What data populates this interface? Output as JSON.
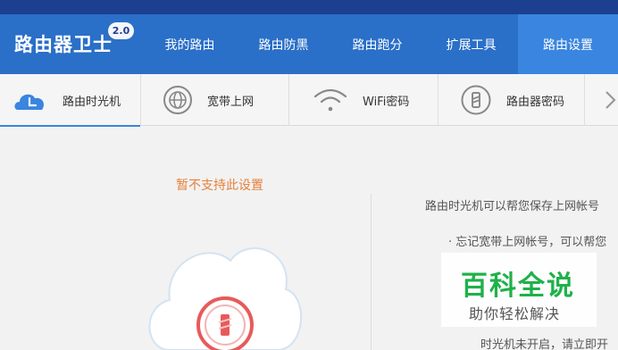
{
  "header": {
    "brand": "路由器卫士",
    "version_badge": "2.0",
    "nav": [
      "我的路由",
      "路由防黑",
      "路由跑分",
      "扩展工具",
      "路由设置"
    ],
    "active_nav": "路由设置",
    "colors": {
      "bar": "#2a6fc8",
      "active": "#3a85df"
    }
  },
  "tabs": [
    {
      "label": "路由时光机",
      "icon": "clock-icon",
      "active": true
    },
    {
      "label": "宽带上网",
      "icon": "globe-icon",
      "active": false
    },
    {
      "label": "WiFi密码",
      "icon": "wifi-icon",
      "active": false
    },
    {
      "label": "路由器密码",
      "icon": "lock-icon",
      "active": false
    },
    {
      "label": "",
      "icon": "chevron-right-icon",
      "active": false
    }
  ],
  "main": {
    "notice": "暂不支持此设置",
    "cloud_icon": "cloud-lock-icon",
    "info_lines": [
      "路由时光机可以帮您保存上网帐号",
      "· 忘记宽带上网帐号，可以帮您",
      "时光机未开启，请立即开"
    ]
  },
  "watermark": {
    "title": "百科全说",
    "subtitle": "助你轻松解决"
  }
}
